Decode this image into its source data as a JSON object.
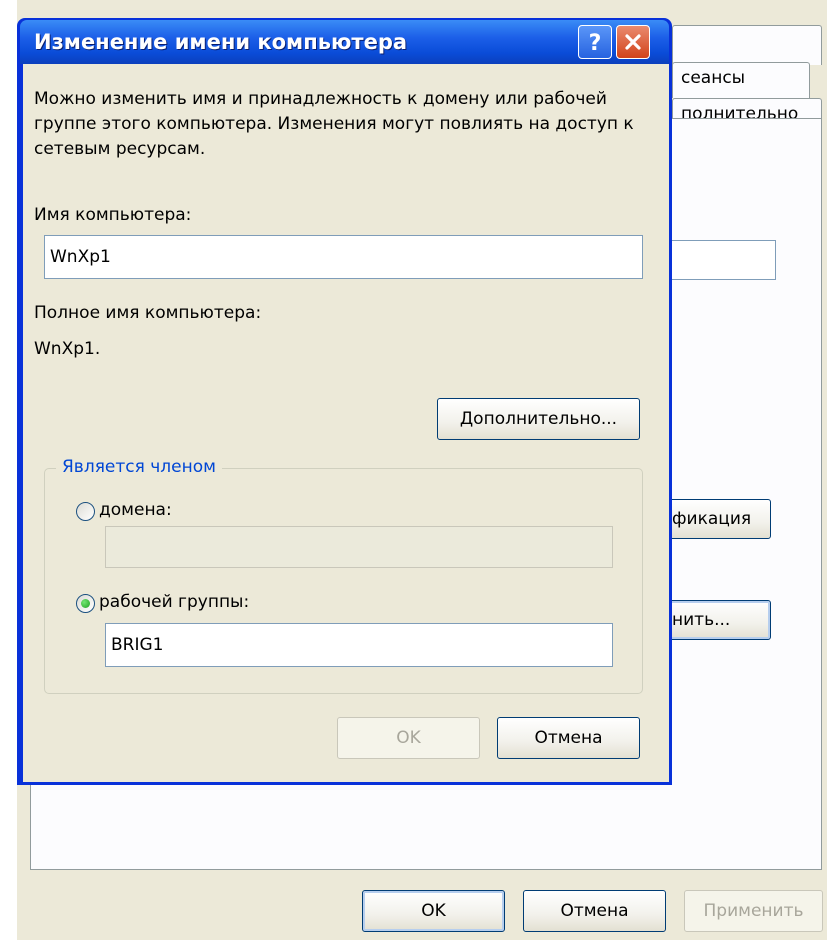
{
  "background_window": {
    "tabs": [
      "",
      "сеансы",
      "полнительно"
    ],
    "buttons": {
      "identification": "фикация",
      "change": "нить...",
      "ok": "OK",
      "cancel": "Отмена",
      "apply": "Применить"
    }
  },
  "dialog": {
    "title": "Изменение имени компьютера",
    "description": "Можно изменить имя и принадлежность к домену или рабочей группе этого компьютера. Изменения могут повлиять на доступ к сетевым ресурсам.",
    "computer_name_label": "Имя компьютера:",
    "computer_name_value": "WnXp1",
    "full_name_label": "Полное имя компьютера:",
    "full_name_value": "WnXp1.",
    "more_button": "Дополнительно...",
    "member_of": {
      "legend": "Является членом",
      "domain_label": "домена:",
      "domain_value": "",
      "domain_selected": false,
      "workgroup_label": "рабочей группы:",
      "workgroup_value": "BRIG1",
      "workgroup_selected": true
    },
    "ok_button": "OK",
    "cancel_button": "Отмена"
  },
  "icons": {
    "help": "help-icon",
    "close": "close-icon"
  }
}
